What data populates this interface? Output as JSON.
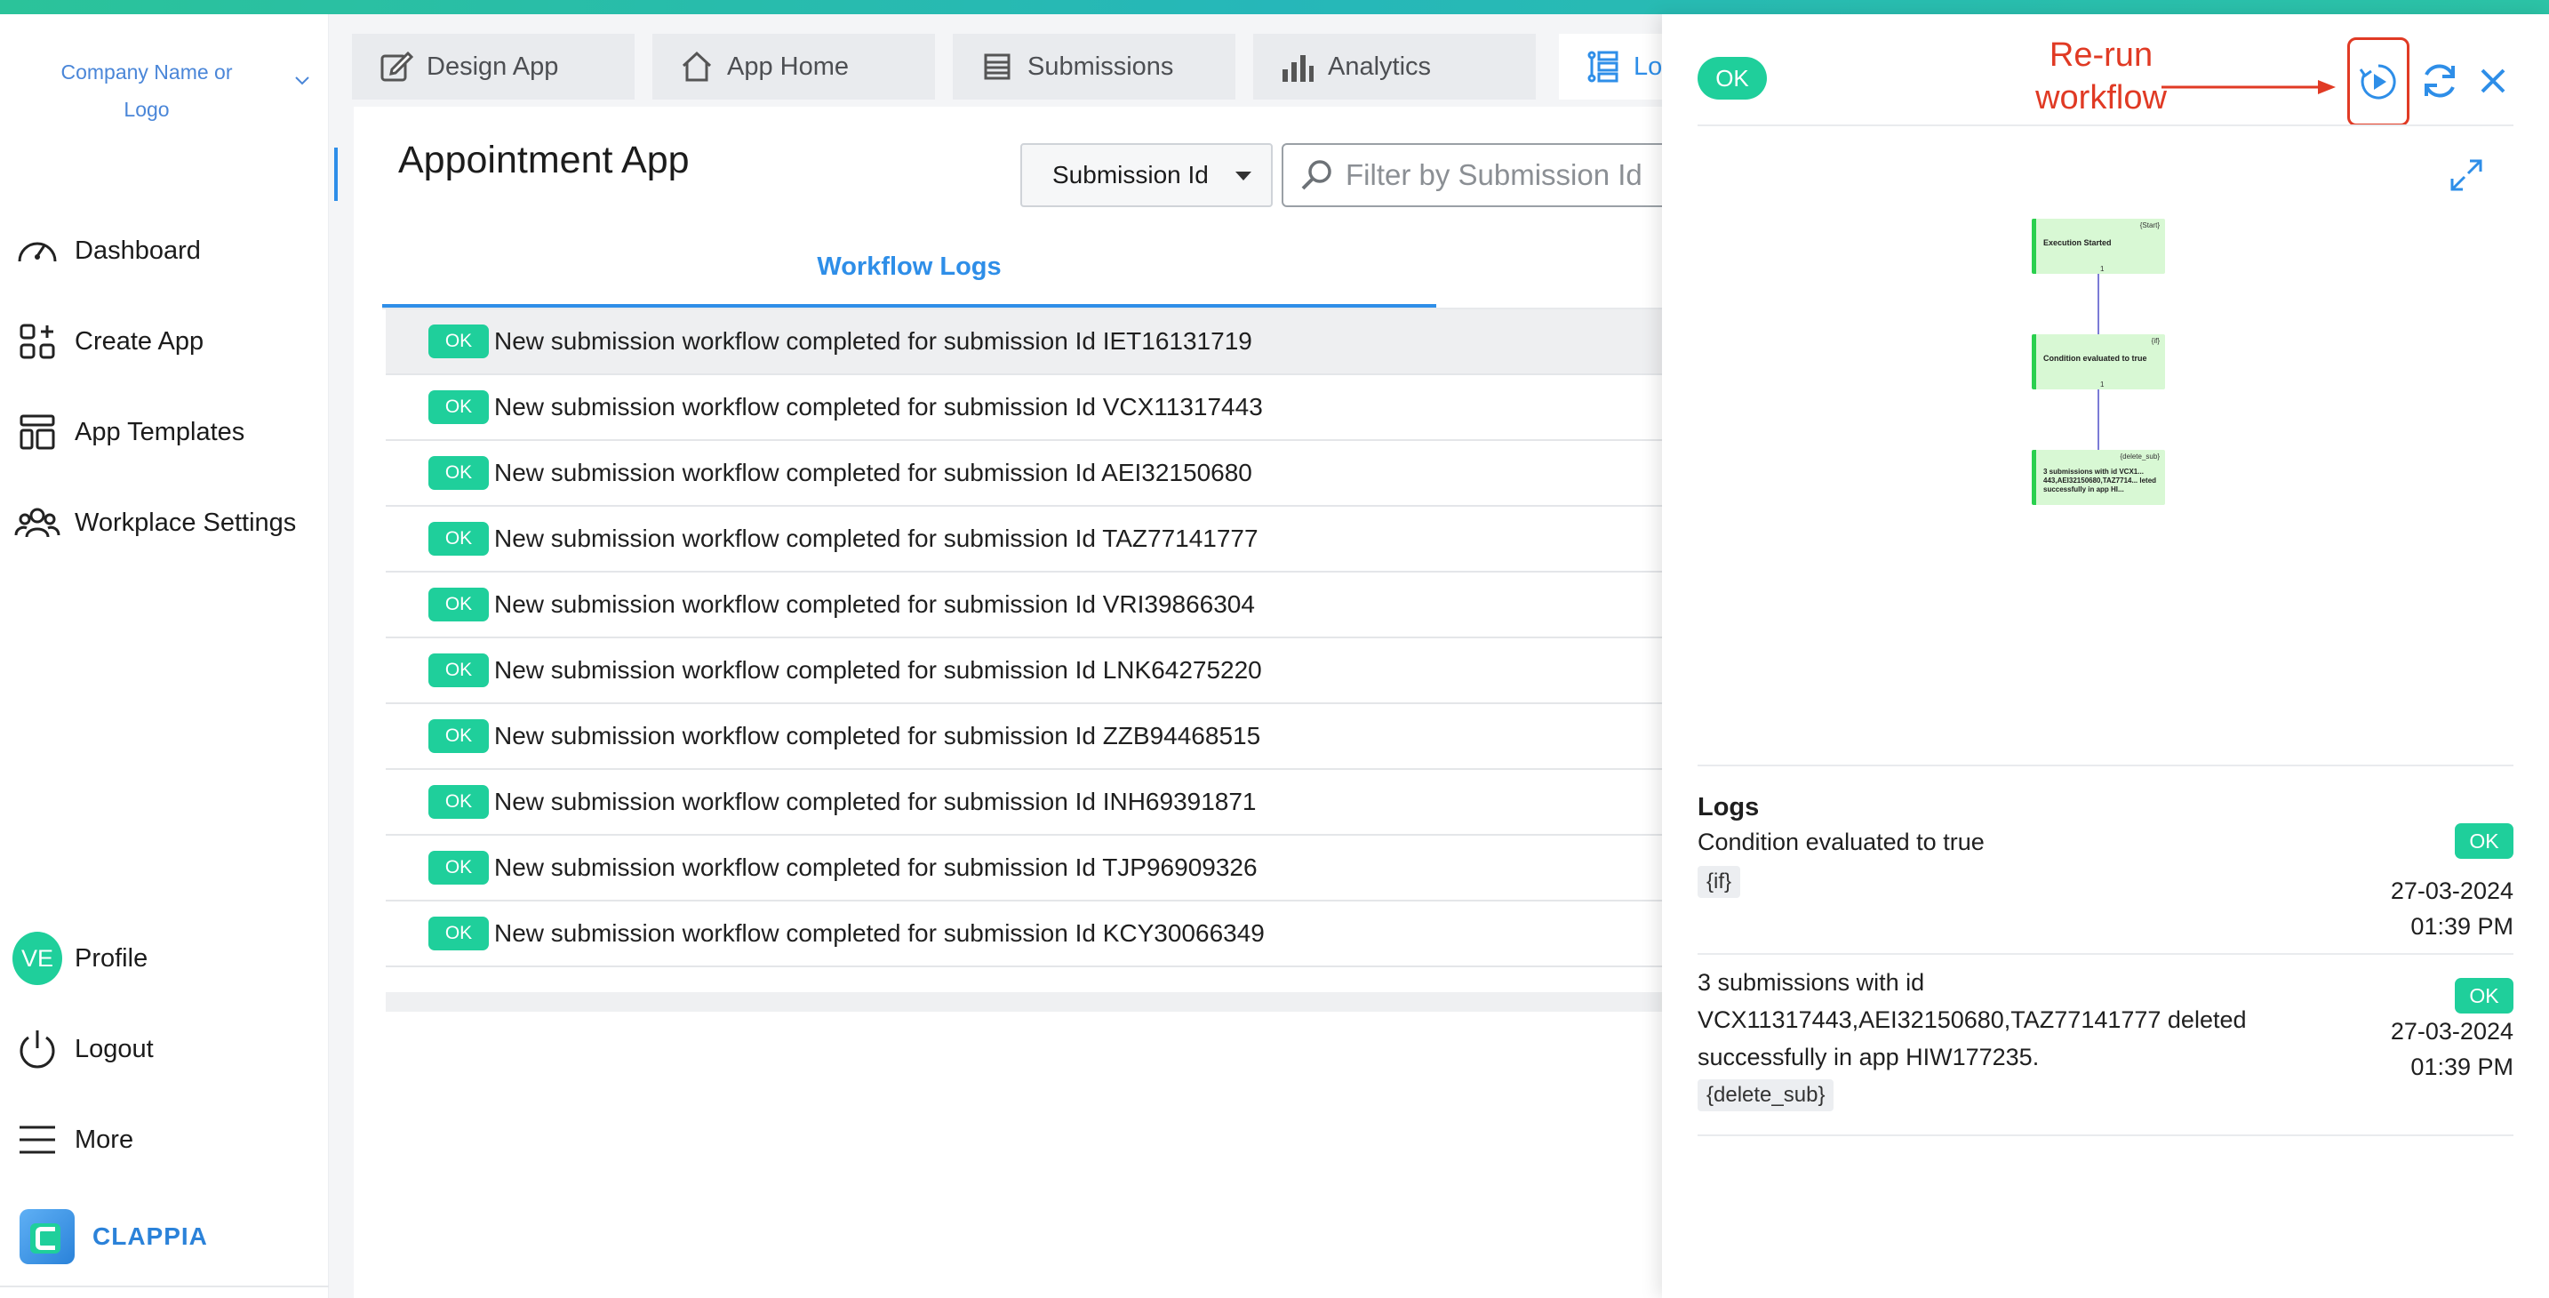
{
  "sidebar": {
    "company": "Company Name or Logo",
    "nav": [
      {
        "label": "Dashboard",
        "icon": "gauge-icon"
      },
      {
        "label": "Create App",
        "icon": "apps-add-icon"
      },
      {
        "label": "App Templates",
        "icon": "templates-icon"
      },
      {
        "label": "Workplace Settings",
        "icon": "team-icon"
      }
    ],
    "profile": {
      "initials": "VE",
      "label": "Profile"
    },
    "logout": "Logout",
    "more": "More",
    "brand": "CLAPPIA"
  },
  "tabs": [
    {
      "label": "Design App",
      "icon": "edit-icon"
    },
    {
      "label": "App Home",
      "icon": "home-icon"
    },
    {
      "label": "Submissions",
      "icon": "list-icon"
    },
    {
      "label": "Analytics",
      "icon": "bar-chart-icon"
    },
    {
      "label": "Logs",
      "icon": "logs-icon"
    }
  ],
  "main": {
    "app_title": "Appointment App",
    "filter_select": "Submission Id",
    "search_placeholder": "Filter by Submission Id",
    "workflow_tab": "Workflow Logs",
    "rows": [
      {
        "status": "OK",
        "text": "New submission workflow completed for submission Id IET16131719"
      },
      {
        "status": "OK",
        "text": "New submission workflow completed for submission Id VCX11317443"
      },
      {
        "status": "OK",
        "text": "New submission workflow completed for submission Id AEI32150680"
      },
      {
        "status": "OK",
        "text": "New submission workflow completed for submission Id TAZ77141777"
      },
      {
        "status": "OK",
        "text": "New submission workflow completed for submission Id VRI39866304"
      },
      {
        "status": "OK",
        "text": "New submission workflow completed for submission Id LNK64275220"
      },
      {
        "status": "OK",
        "text": "New submission workflow completed for submission Id ZZB94468515"
      },
      {
        "status": "OK",
        "text": "New submission workflow completed for submission Id INH69391871"
      },
      {
        "status": "OK",
        "text": "New submission workflow completed for submission Id TJP96909326"
      },
      {
        "status": "OK",
        "text": "New submission workflow completed for submission Id KCY30066349"
      }
    ]
  },
  "panel": {
    "status": "OK",
    "annotation_line1": "Re-run",
    "annotation_line2": "workflow",
    "flow": [
      {
        "tag": "{Start}",
        "label": "Execution Started",
        "num": "1"
      },
      {
        "tag": "{if}",
        "label": "Condition evaluated to true",
        "num": "1"
      },
      {
        "tag": "{delete_sub}",
        "label": "3 submissions with id VCX1... 443,AEI32150680,TAZ7714... leted successfully in app HI..."
      }
    ],
    "logs_title": "Logs",
    "logs": [
      {
        "message": "Condition evaluated to true",
        "tag": "{if}",
        "status": "OK",
        "date": "27-03-2024",
        "time": "01:39 PM"
      },
      {
        "message": "3 submissions with id VCX11317443,AEI32150680,TAZ77141777 deleted successfully in app HIW177235.",
        "tag": "{delete_sub}",
        "status": "OK",
        "date": "27-03-2024",
        "time": "01:39 PM"
      }
    ]
  },
  "colors": {
    "accent": "#2e8ee8",
    "ok_green": "#1fcf9b",
    "annotation_red": "#e03a24",
    "node_green": "#d8f8d4"
  }
}
